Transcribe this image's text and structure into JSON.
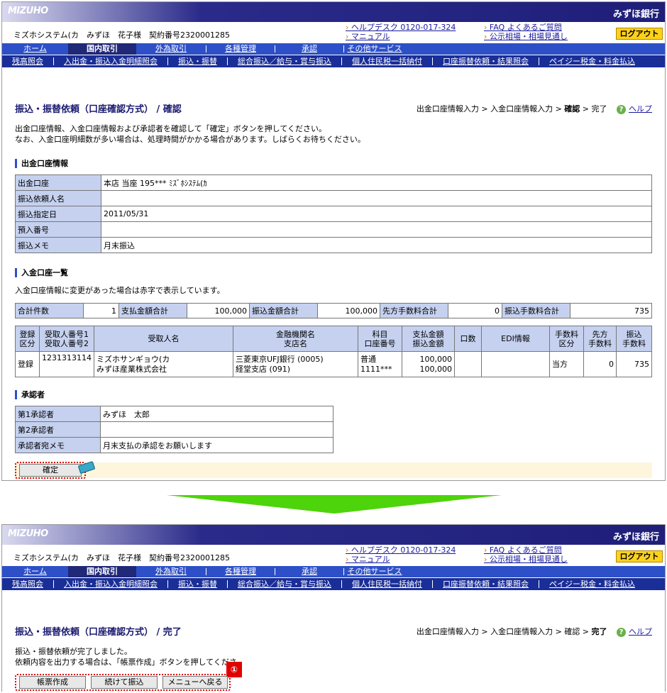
{
  "header": {
    "logo": "MIZUHO",
    "brand": "みずほ銀行",
    "user_info": "ミズホシステム(カ　みずほ　花子様　契約番号2320001285",
    "links_left": [
      "ヘルプデスク 0120-017-324",
      "マニュアル"
    ],
    "links_right": [
      "FAQ よくあるご質問",
      "公示相場・相場見通し"
    ],
    "logout": "ログアウト"
  },
  "nav_main": [
    "ホーム",
    "国内取引",
    "外為取引",
    "各種管理",
    "承認",
    "その他サービス"
  ],
  "nav_main_active": "国内取引",
  "nav_sub": [
    "残高照会",
    "入出金・振込入金明細照会",
    "振込・振替",
    "総合振込／給与・賞与振込",
    "個人住民税一括納付",
    "口座振替依頼・結果照会",
    "ペイジー税金・料金払込"
  ],
  "confirm_page": {
    "title": "振込・振替依頼（口座確認方式） / 確認",
    "crumb_before": "出金口座情報入力 > 入金口座情報入力 > ",
    "crumb_current": "確認",
    "crumb_after": " > 完了",
    "help": "ヘルプ",
    "instructions": [
      "出金口座情報、入金口座情報および承認者を確認して「確定」ボタンを押してください。",
      "なお、入金口座明細数が多い場合は、処理時間がかかる場合があります。しばらくお待ちください。"
    ],
    "debit_section": {
      "title": "出金口座情報",
      "rows": [
        {
          "label": "出金口座",
          "value": "本店 当座 195*** ﾐｽﾞﾎｼｽﾃﾑ(ｶ"
        },
        {
          "label": "振込依頼人名",
          "value": ""
        },
        {
          "label": "振込指定日",
          "value": "2011/05/31"
        },
        {
          "label": "預入番号",
          "value": ""
        },
        {
          "label": "振込メモ",
          "value": "月末振込"
        }
      ]
    },
    "credit_section": {
      "title": "入金口座一覧",
      "note": "入金口座情報に変更があった場合は赤字で表示しています。",
      "summary": [
        {
          "label": "合計件数",
          "value": "1"
        },
        {
          "label": "支払金額合計",
          "value": "100,000"
        },
        {
          "label": "振込金額合計",
          "value": "100,000"
        },
        {
          "label": "先方手数料合計",
          "value": "0"
        },
        {
          "label": "振込手数料合計",
          "value": "735"
        }
      ],
      "headers": [
        "登録\n区分",
        "受取人番号1\n受取人番号2",
        "受取人名",
        "金融機関名\n支店名",
        "科目\n口座番号",
        "支払金額\n振込金額",
        "口数",
        "EDI情報",
        "手数料\n区分",
        "先方\n手数料",
        "振込\n手数料"
      ],
      "row": {
        "reg": "登録",
        "recipient_no": "1231313114",
        "name1": "ミズホサンギョウ(カ",
        "name2": "みずほ産業株式会社",
        "bank1": "三菱東京UFJ銀行 (0005)",
        "bank2": "経堂支店 (091)",
        "acct1": "普通",
        "acct2": "1111***",
        "amt1": "100,000",
        "amt2": "100,000",
        "units": "",
        "edi": "",
        "fee_type": "当方",
        "payee_fee": "0",
        "transfer_fee": "735"
      }
    },
    "approver_section": {
      "title": "承認者",
      "rows": [
        {
          "label": "第1承認者",
          "value": "みずほ　太郎"
        },
        {
          "label": "第2承認者",
          "value": ""
        },
        {
          "label": "承認者宛メモ",
          "value": "月末支払の承認をお願いします"
        }
      ]
    },
    "confirm_button": "確定"
  },
  "complete_page": {
    "title": "振込・振替依頼（口座確認方式） / 完了",
    "crumb_before": "出金口座情報入力 > 入金口座情報入力 > 確認 > ",
    "crumb_current": "完了",
    "help": "ヘルプ",
    "messages": [
      "振込・振替依頼が完了しました。",
      "依頼内容を出力する場合は、「帳票作成」ボタンを押してくださ"
    ],
    "buttons": [
      "帳票作成",
      "続けて振込",
      "メニューへ戻る"
    ],
    "badge": "①"
  },
  "colors": {
    "accent_red": "#e00000",
    "nav_blue": "#2d50c8",
    "arrow_green": "#4dd40a",
    "logout_yellow": "#ffd21a"
  }
}
